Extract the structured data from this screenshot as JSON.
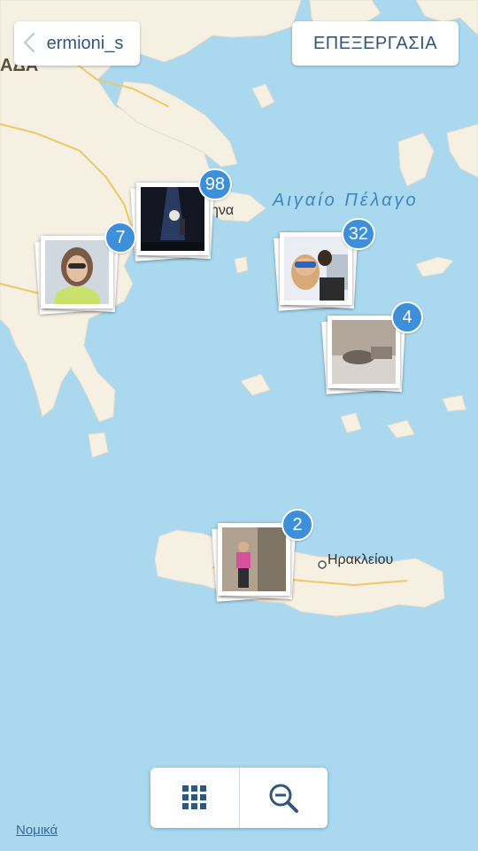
{
  "header": {
    "back_label": "ermioni_s",
    "edit_label": "ΕΠΕΞΕΡΓΑΣΙΑ"
  },
  "map_labels": {
    "country_fragment": "ΑΔΑ",
    "sea": "Αιγαίο Πέλαγο",
    "athens_fragment": "ηνα",
    "heraklion": "Ηρακλείου"
  },
  "clusters": [
    {
      "count": "98",
      "thumb": "concert"
    },
    {
      "count": "7",
      "thumb": "selfie-woman"
    },
    {
      "count": "32",
      "thumb": "selfie-couple"
    },
    {
      "count": "4",
      "thumb": "bedroom"
    },
    {
      "count": "2",
      "thumb": "woman-by-wall"
    }
  ],
  "toolbar": {
    "grid_icon": "grid-icon",
    "zoom_out_icon": "zoom-out-icon"
  },
  "footer": {
    "legal_label": "Νομικά"
  },
  "colors": {
    "sea": "#a9d8ef",
    "land": "#f5f0e2",
    "badge": "#3d8fd9",
    "text_blue": "#30567c",
    "road": "#f0c765"
  }
}
